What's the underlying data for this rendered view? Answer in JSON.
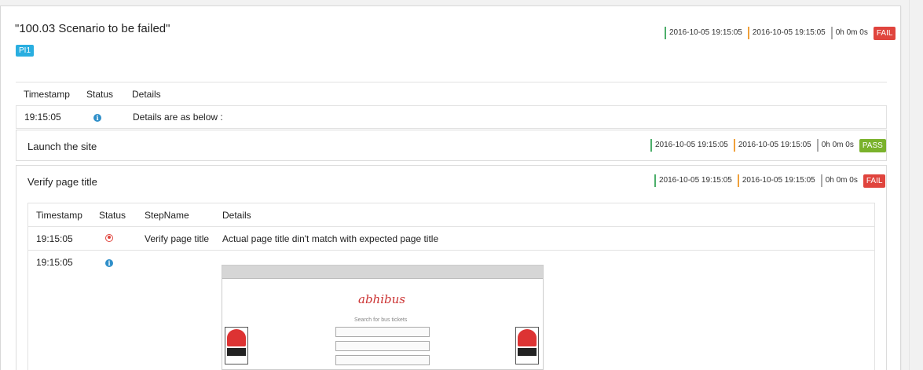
{
  "test": {
    "title": "\"100.03 Scenario to be failed\"",
    "category": "PI1",
    "start_time": "2016-10-05 19:15:05",
    "end_time": "2016-10-05 19:15:05",
    "duration": "0h 0m 0s",
    "status": "FAIL"
  },
  "log_table": {
    "headers": {
      "timestamp": "Timestamp",
      "status": "Status",
      "details": "Details"
    },
    "rows": [
      {
        "timestamp": "19:15:05",
        "status_icon": "info-icon",
        "details": "Details are as below :"
      }
    ]
  },
  "nodes": [
    {
      "title": "Launch the site",
      "start_time": "2016-10-05 19:15:05",
      "end_time": "2016-10-05 19:15:05",
      "duration": "0h 0m 0s",
      "status": "PASS"
    },
    {
      "title": "Verify page title",
      "start_time": "2016-10-05 19:15:05",
      "end_time": "2016-10-05 19:15:05",
      "duration": "0h 0m 0s",
      "status": "FAIL",
      "table": {
        "headers": {
          "timestamp": "Timestamp",
          "status": "Status",
          "stepname": "StepName",
          "details": "Details"
        },
        "rows": [
          {
            "timestamp": "19:15:05",
            "status_icon": "error-icon",
            "stepname": "Verify page title",
            "details": "Actual page title din't match with expected page title"
          },
          {
            "timestamp": "19:15:05",
            "status_icon": "info-icon",
            "stepname": "",
            "details": ""
          }
        ]
      }
    }
  ],
  "screenshot": {
    "logo": "abhibus",
    "subtitle": "Search for bus tickets"
  },
  "colors": {
    "fail": "#e0443d",
    "pass": "#7ab22c",
    "category": "#29aee0",
    "info": "#2f8fc9"
  }
}
